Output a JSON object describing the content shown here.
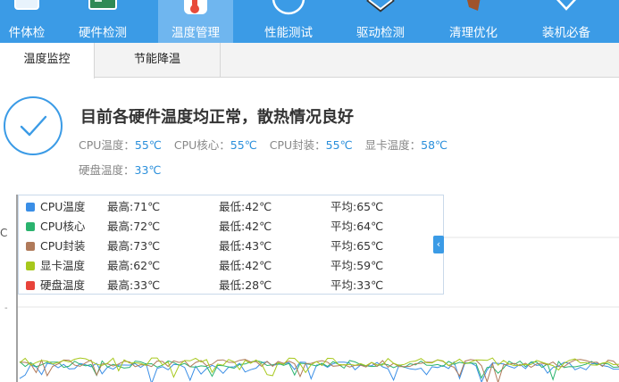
{
  "nav": {
    "items": [
      {
        "label": "件体检",
        "icon": "checkup-icon"
      },
      {
        "label": "硬件检测",
        "icon": "hardware-icon"
      },
      {
        "label": "温度管理",
        "icon": "thermometer-icon"
      },
      {
        "label": "性能测试",
        "icon": "gauge-icon"
      },
      {
        "label": "驱动检测",
        "icon": "driver-icon"
      },
      {
        "label": "清理优化",
        "icon": "broom-icon"
      },
      {
        "label": "装机必备",
        "icon": "package-icon"
      }
    ],
    "active_index": 2
  },
  "tabs": [
    {
      "label": "温度监控"
    },
    {
      "label": "节能降温"
    }
  ],
  "status": {
    "headline": "目前各硬件温度均正常，散热情况良好",
    "temps": [
      {
        "label": "CPU温度：",
        "value": "55℃"
      },
      {
        "label": "CPU核心：",
        "value": "55℃"
      },
      {
        "label": "CPU封装：",
        "value": "55℃"
      },
      {
        "label": "显卡温度：",
        "value": "58℃"
      },
      {
        "label": "硬盘温度：",
        "value": "33℃"
      }
    ]
  },
  "chart": {
    "unit_label": "C",
    "side_tick": "-",
    "collapse_glyph": "‹",
    "legend": [
      {
        "name": "CPU温度",
        "max": "最高:71℃",
        "min": "最低:42℃",
        "avg": "平均:65℃",
        "color": "#3a8ee6"
      },
      {
        "name": "CPU核心",
        "max": "最高:72℃",
        "min": "最低:42℃",
        "avg": "平均:64℃",
        "color": "#2bb36e"
      },
      {
        "name": "CPU封装",
        "max": "最高:73℃",
        "min": "最低:43℃",
        "avg": "平均:65℃",
        "color": "#b07a5a"
      },
      {
        "name": "显卡温度",
        "max": "最高:62℃",
        "min": "最低:42℃",
        "avg": "平均:59℃",
        "color": "#a7c81c"
      },
      {
        "name": "硬盘温度",
        "max": "最高:33℃",
        "min": "最低:28℃",
        "avg": "平均:33℃",
        "color": "#e8433a"
      }
    ]
  }
}
